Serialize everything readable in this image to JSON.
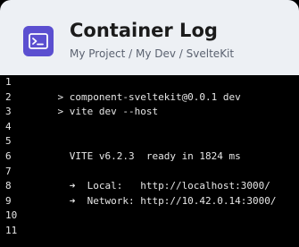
{
  "header": {
    "title": "Container Log",
    "breadcrumb": "My Project / My Dev / SvelteKit",
    "icon": "terminal-icon",
    "icon_color": "#5b4fd0",
    "background": "#edf0f4"
  },
  "log": {
    "background": "#000000",
    "text_color": "#e6e6e6",
    "lines": [
      {
        "num": "1",
        "text": ""
      },
      {
        "num": "2",
        "text": "    > component-sveltekit@0.0.1 dev"
      },
      {
        "num": "3",
        "text": "    > vite dev --host"
      },
      {
        "num": "4",
        "text": ""
      },
      {
        "num": "5",
        "text": ""
      },
      {
        "num": "6",
        "text": "      VITE v6.2.3  ready in 1824 ms"
      },
      {
        "num": "7",
        "text": ""
      },
      {
        "num": "8",
        "text": "      ➜  Local:   http://localhost:3000/"
      },
      {
        "num": "9",
        "text": "      ➜  Network: http://10.42.0.14:3000/"
      },
      {
        "num": "10",
        "text": ""
      },
      {
        "num": "11",
        "text": ""
      }
    ]
  }
}
